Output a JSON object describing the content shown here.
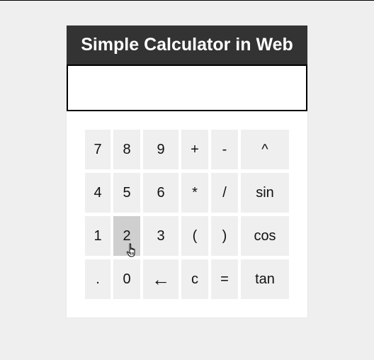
{
  "calculator": {
    "title": "Simple Calculator in Web",
    "display_value": ""
  },
  "keys": {
    "r1": [
      "7",
      "8",
      "9",
      "+",
      "-",
      "^"
    ],
    "r2": [
      "4",
      "5",
      "6",
      "*",
      "/",
      "sin"
    ],
    "r3": [
      "1",
      "2",
      "3",
      "(",
      ")",
      "cos"
    ],
    "r4": [
      ".",
      "0",
      "←",
      "c",
      "=",
      "tan"
    ]
  },
  "state": {
    "pressed_key": "2"
  },
  "colors": {
    "page_background": "#efefef",
    "title_background": "#333333",
    "title_text": "#ffffff",
    "key_background": "#efefef",
    "key_pressed_background": "#cfcfcf"
  },
  "icons": {
    "cursor": "hand-pointer-icon"
  }
}
